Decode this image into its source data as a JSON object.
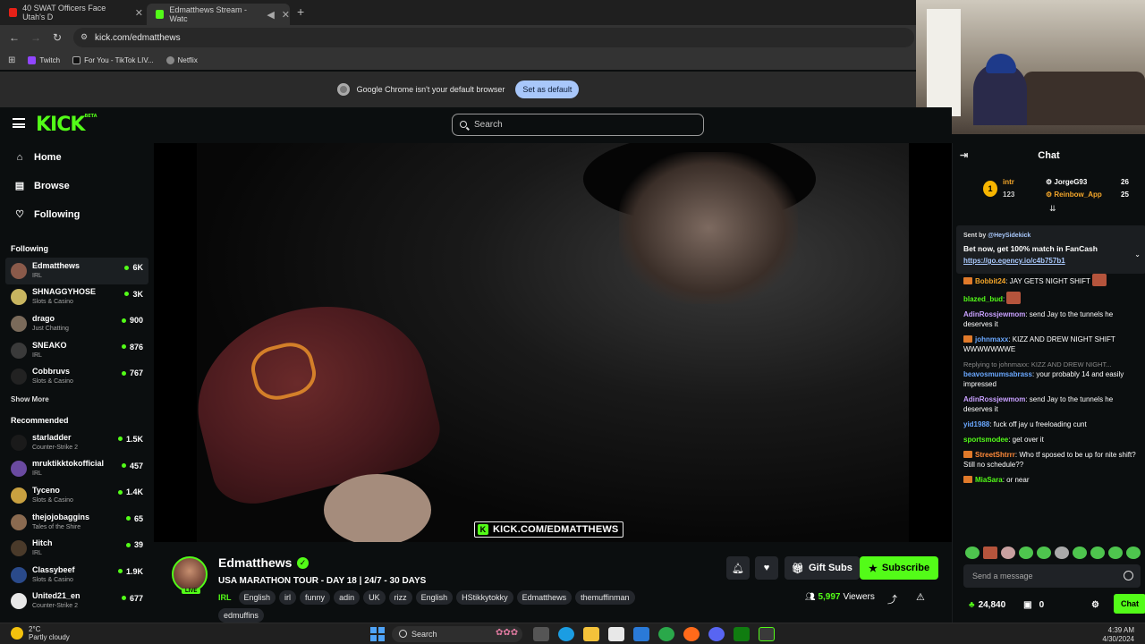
{
  "browser": {
    "tabs": [
      {
        "label": "40 SWAT Officers Face Utah's D",
        "icon_color": "#e62117"
      },
      {
        "label": "Edmatthews Stream - Watc",
        "icon_color": "#53fc18"
      }
    ],
    "new_tab": "+",
    "url": "kick.com/edmatthews",
    "bookmarks": [
      {
        "label": "Twitch",
        "icon_color": "#9146ff"
      },
      {
        "label": "For You - TikTok LIV...",
        "icon_color": "#111111"
      },
      {
        "label": "Netflix",
        "icon_color": "#e50914"
      }
    ],
    "infobar": {
      "message": "Google Chrome isn't your default browser",
      "button": "Set as default"
    }
  },
  "kick": {
    "logo": "KICK",
    "logo_sup": "BETA",
    "search_placeholder": "Search",
    "brand_color": "#53fc18"
  },
  "sidebar": {
    "nav": [
      {
        "label": "Home",
        "icon": "home-icon",
        "glyph": "⌂"
      },
      {
        "label": "Browse",
        "icon": "browse-icon",
        "glyph": "▤"
      },
      {
        "label": "Following",
        "icon": "heart-icon",
        "glyph": "♡"
      }
    ],
    "following_title": "Following",
    "following": [
      {
        "name": "Edmatthews",
        "category": "IRL",
        "viewers": "6K",
        "avatar_color": "#8a5a4a"
      },
      {
        "name": "SHNAGGYHOSE",
        "category": "Slots & Casino",
        "viewers": "3K",
        "avatar_color": "#c8b560"
      },
      {
        "name": "drago",
        "category": "Just Chatting",
        "viewers": "900",
        "avatar_color": "#7a6a5a"
      },
      {
        "name": "SNEAKO",
        "category": "IRL",
        "viewers": "876",
        "avatar_color": "#3a3a3a"
      },
      {
        "name": "Cobbruvs",
        "category": "Slots & Casino",
        "viewers": "767",
        "avatar_color": "#222222"
      }
    ],
    "show_more": "Show More",
    "recommended_title": "Recommended",
    "recommended": [
      {
        "name": "starladder",
        "category": "Counter-Strike 2",
        "viewers": "1.5K",
        "avatar_color": "#1a1a1a"
      },
      {
        "name": "mruktikktokofficial",
        "category": "IRL",
        "viewers": "457",
        "avatar_color": "#6a4aa0"
      },
      {
        "name": "Tyceno",
        "category": "Slots & Casino",
        "viewers": "1.4K",
        "avatar_color": "#c8a040"
      },
      {
        "name": "thejojobaggins",
        "category": "Tales of the Shire",
        "viewers": "65",
        "avatar_color": "#8a6a50"
      },
      {
        "name": "Hitch",
        "category": "IRL",
        "viewers": "39",
        "avatar_color": "#4a3a2a"
      },
      {
        "name": "Classybeef",
        "category": "Slots & Casino",
        "viewers": "1.9K",
        "avatar_color": "#2a4a8a"
      },
      {
        "name": "United21_en",
        "category": "Counter-Strike 2",
        "viewers": "677",
        "avatar_color": "#e8e8e8"
      }
    ]
  },
  "video": {
    "watermark": "KICK.COM/EDMATTHEWS"
  },
  "stream": {
    "streamer": "Edmatthews",
    "live_badge": "LIVE",
    "title": "USA MARATHON TOUR - DAY 18 | 24/7 - 30 DAYS",
    "category": "IRL",
    "tags": [
      "English",
      "irl",
      "funny",
      "adin",
      "UK",
      "rizz",
      "English",
      "HStikkytokky",
      "Edmatthews",
      "themuffinman",
      "edmuffins"
    ],
    "gift_subs": "Gift Subs",
    "subscribe": "Subscribe",
    "viewers_count": "5,997",
    "viewers_label": "Viewers"
  },
  "chat": {
    "title": "Chat",
    "leaderboard": {
      "rank_label": "1",
      "top_name": "intr",
      "top_count": "123",
      "entries": [
        {
          "name": "JorgeG93",
          "count": "26",
          "color": "#ffffff"
        },
        {
          "name": "Reinbow_App",
          "count": "25",
          "color": "#f4a62a"
        }
      ]
    },
    "pinned": {
      "sent_by_label": "Sent by",
      "sent_by_user": "@HeySidekick",
      "promo": "Bet now, get 100% match in FanCash",
      "link": "https://go.egency.io/c4b757b1"
    },
    "messages": [
      {
        "user": "Bobbit24",
        "color": "#f4a62a",
        "text": ": JAY GETS NIGHT SHIFT",
        "badge": true
      },
      {
        "user": "blazed_bud",
        "color": "#53fc18",
        "text": ":",
        "badge": false
      },
      {
        "user": "AdinRossjewmom",
        "color": "#c8a0ff",
        "text": ": send Jay to the tunnels he deserves it",
        "badge": false
      },
      {
        "user": "johnmaxx",
        "color": "#6aa8ff",
        "text": ": KIZZ AND DREW NIGHT SHIFT WWWWWWWE",
        "badge": true
      },
      {
        "user": "beavosmumsabrass",
        "color": "#6aa8ff",
        "text": ": your probably 14 and easily impressed",
        "badge": false,
        "reply": "Replying to johnmaxx: KIZZ AND DREW NIGHT..."
      },
      {
        "user": "AdinRossjewmom",
        "color": "#c8a0ff",
        "text": ": send Jay to the tunnels he deserves it",
        "badge": false
      },
      {
        "user": "yid1988",
        "color": "#6aa8ff",
        "text": ": fuck off jay u freeloading cunt",
        "badge": false
      },
      {
        "user": "sportsmodee",
        "color": "#53fc18",
        "text": ": get over it",
        "badge": false
      },
      {
        "user": "StreetShtrrr",
        "color": "#ff8a3a",
        "text": ": Who tf sposed to be up for nite shift? Still no schedule??",
        "badge": true
      },
      {
        "user": "MiaSara",
        "color": "#53fc18",
        "text": ": or near",
        "badge": true
      }
    ],
    "input_placeholder": "Send a message",
    "points": "24,840",
    "gifts": "0",
    "chat_button": "Chat"
  },
  "taskbar": {
    "temperature": "2°C",
    "weather": "Partly cloudy",
    "search": "Search",
    "time": "4:39 AM",
    "date": "4/30/2024"
  }
}
